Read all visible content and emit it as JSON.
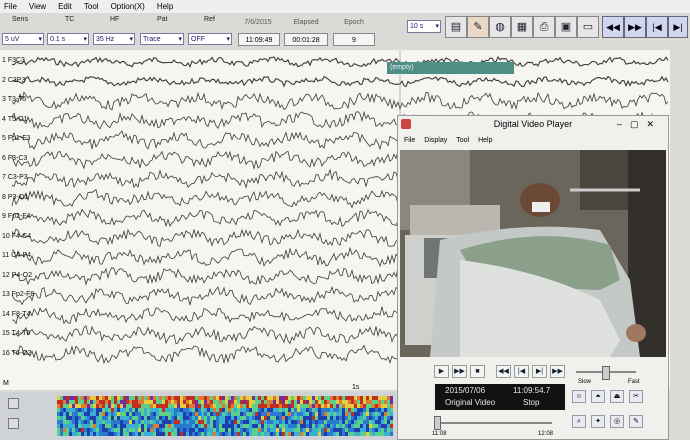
{
  "menu": [
    "File",
    "View",
    "Edit",
    "Tool",
    "Option(X)",
    "Help"
  ],
  "params": {
    "labels": [
      "Sens",
      "TC",
      "HF",
      "Pat",
      "Ref"
    ],
    "values": [
      "5 uV",
      "0.1 s",
      "35 Hz",
      "Trace",
      "OFF"
    ]
  },
  "info": {
    "date": "7/6/2015",
    "time": "11:09:49",
    "elapsed_label": "Elapsed",
    "elapsed": "00:01:28",
    "epoch_label": "Epoch",
    "epoch": "9"
  },
  "toolbar": {
    "speed": "10 s"
  },
  "channels": [
    "Fp1-F3",
    "F3-C3",
    "C3-P3",
    "P3-O1",
    "Fp1-F7",
    "F7-T3",
    "T3-T5",
    "T5-O1",
    "Fp2-F4",
    "F4-C4",
    "C4-P4",
    "P4-O2",
    "Fp2-F8",
    "F8-T4",
    "T4-T6",
    "T6-O2"
  ],
  "display_channels": [
    "F3C3",
    "C3P3",
    "T3-T5",
    "T5-O1",
    "Fp1-F3",
    "F3-C3",
    "C3-P3",
    "P3-O1",
    "Fp2-F4",
    "F4-C4",
    "C4-P4",
    "P4-O2",
    "Fp2-F8",
    "F8-T4",
    "T4-T6",
    "T6-O2"
  ],
  "channel_numbers": [
    "1",
    "2",
    "3",
    "4",
    "5",
    "6",
    "7",
    "8",
    "9",
    "10",
    "11",
    "12",
    "13",
    "14",
    "15",
    "16"
  ],
  "marker_m": "M",
  "scale_label": "1s",
  "annotation": "(empty)",
  "video_player": {
    "title": "Digital Video Player",
    "menu": [
      "File",
      "Display",
      "Tool",
      "Help"
    ],
    "date": "2015/07/06",
    "time": "11:09:54.7",
    "mode": "Original Video",
    "state": "Stop",
    "slow": "Slow",
    "fast": "Fast",
    "t_start": "11:08",
    "t_end": "12:08"
  },
  "colors": {
    "trace": "#3a3a3a",
    "background": "#f6f5ef",
    "annotation": "#4f8e83"
  }
}
